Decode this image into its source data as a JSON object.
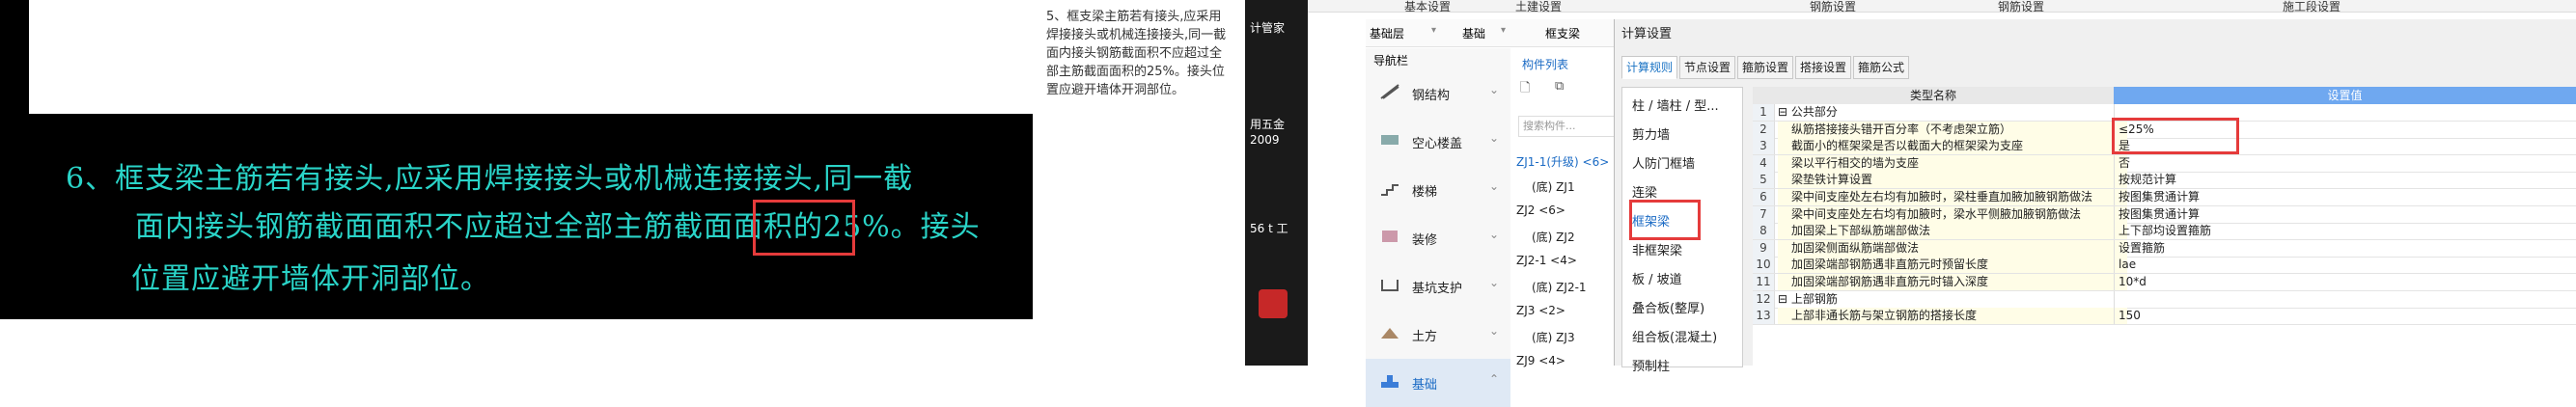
{
  "cad": {
    "line1": "6、框支梁主筋若有接头,应采用焊接接头或机械连接接头,同一截",
    "line2": "面内接头钢筋截面面积不应超过全部主筋截面面积的25%。接头",
    "line3": "位置应避开墙体开洞部位。"
  },
  "clip_text": "5、框支梁主筋若有接头,应采用焊接接头或机械连接接头,同一截面内接头钢筋截面积不应超过全部主筋截面面积的25%。接头位置应避开墙体开洞部位。",
  "desktop": {
    "label1": "计管家",
    "label2": "用五金",
    "label3": "2009",
    "label4": "56 t 工"
  },
  "top_tabs": [
    "基本设置",
    "土建设置",
    "钢筋设置",
    "钢筋设置",
    "施工段设置"
  ],
  "toolbar": {
    "floor": "基础层",
    "category": "基础",
    "beam": "框支梁"
  },
  "nav": {
    "title": "导航栏",
    "items": [
      "钢结构",
      "空心楼盖",
      "楼梯",
      "装修",
      "基坑支护",
      "土方",
      "基础"
    ]
  },
  "components": {
    "tab_list": "构件列表",
    "search_placeholder": "搜索构件...",
    "items": [
      "ZJ1-1(升级) <6>",
      "(底) ZJ1",
      "ZJ2 <6>",
      "(底) ZJ2",
      "ZJ2-1 <4>",
      "(底) ZJ2-1",
      "ZJ3 <2>",
      "(底) ZJ3",
      "ZJ9 <4>"
    ]
  },
  "dialog": {
    "title": "计算设置",
    "tabs": [
      "计算规则",
      "节点设置",
      "箍筋设置",
      "搭接设置",
      "箍筋公式"
    ],
    "categories": [
      "柱 / 墙柱 / 型...",
      "剪力墙",
      "人防门框墙",
      "连梁",
      "框架梁",
      "非框架梁",
      "板 / 坡道",
      "叠合板(整厚)",
      "组合板(混凝土)",
      "预制柱"
    ],
    "col_name": "类型名称",
    "col_value": "设置值",
    "rows": [
      {
        "no": "1",
        "name": "⊟ 公共部分",
        "value": "",
        "group": true
      },
      {
        "no": "2",
        "name": "纵筋搭接接头错开百分率（不考虑架立筋）",
        "value": "≤25%"
      },
      {
        "no": "3",
        "name": "截面小的框架梁是否以截面大的框架梁为支座",
        "value": "是"
      },
      {
        "no": "4",
        "name": "梁以平行相交的墙为支座",
        "value": "否"
      },
      {
        "no": "5",
        "name": "梁垫铁计算设置",
        "value": "按规范计算"
      },
      {
        "no": "6",
        "name": "梁中间支座处左右均有加腋时，梁柱垂直加腋加腋钢筋做法",
        "value": "按图集贯通计算"
      },
      {
        "no": "7",
        "name": "梁中间支座处左右均有加腋时，梁水平侧腋加腋钢筋做法",
        "value": "按图集贯通计算"
      },
      {
        "no": "8",
        "name": "加固梁上下部纵筋端部做法",
        "value": "上下部均设置箍筋"
      },
      {
        "no": "9",
        "name": "加固梁侧面纵筋端部做法",
        "value": "设置箍筋"
      },
      {
        "no": "10",
        "name": "加固梁端部钢筋遇非直筋元时预留长度",
        "value": "lae"
      },
      {
        "no": "11",
        "name": "加固梁端部钢筋遇非直筋元时锚入深度",
        "value": "10*d"
      },
      {
        "no": "12",
        "name": "⊟ 上部钢筋",
        "value": "",
        "group": true
      },
      {
        "no": "13",
        "name": "上部非通长筋与架立钢筋的搭接长度",
        "value": "150"
      }
    ]
  }
}
